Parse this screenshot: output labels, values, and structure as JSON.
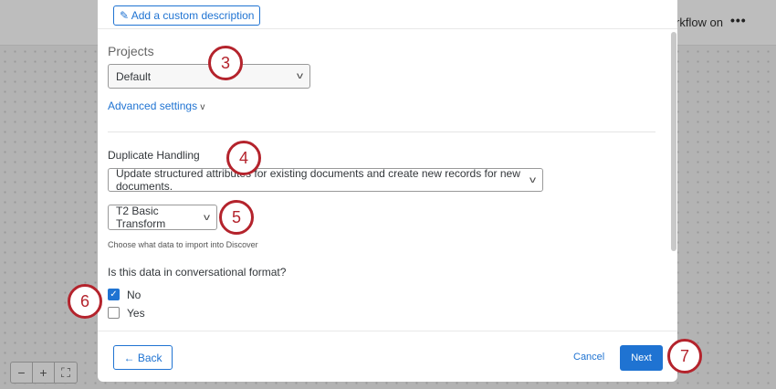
{
  "background": {
    "workflow_text": "rkflow on",
    "more_label": "•••",
    "zoom_out": "−",
    "zoom_in": "+",
    "fit": "⛶"
  },
  "modal": {
    "custom_description": "Add a custom description",
    "projects_label": "Projects",
    "projects_value": "Default",
    "advanced_settings": "Advanced settings",
    "duplicate_label": "Duplicate Handling",
    "duplicate_value": "Update structured attributes for existing documents and create new records for new documents.",
    "transform_value": "T2 Basic Transform",
    "transform_help": "Choose what data to import into Discover",
    "conv_question": "Is this data in conversational format?",
    "options": [
      {
        "label": "No",
        "checked": true
      },
      {
        "label": "Yes",
        "checked": false
      }
    ],
    "back": "Back",
    "cancel": "Cancel",
    "next": "Next"
  },
  "callouts": [
    "3",
    "4",
    "5",
    "6",
    "7"
  ],
  "colors": {
    "accent": "#1f73d2",
    "callout": "#b4232c"
  }
}
